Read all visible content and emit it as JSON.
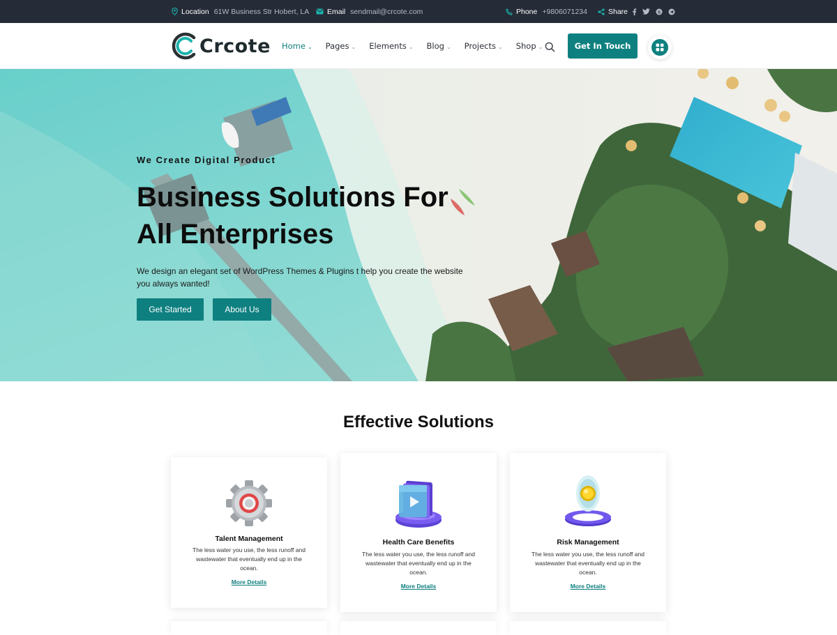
{
  "topbar": {
    "location_label": "Location",
    "location_value": "61W Business Str Hobert, LA",
    "email_label": "Email",
    "email_value": "sendmail@crcote.com",
    "phone_label": "Phone",
    "phone_value": "+9806071234",
    "share_label": "Share",
    "socials": [
      "facebook-icon",
      "twitter-icon",
      "skype-icon",
      "telegram-icon"
    ]
  },
  "brand": {
    "name": "Crcote",
    "accent_color": "#0f8080",
    "topbar_color": "#252b37"
  },
  "nav": {
    "items": [
      {
        "label": "Home",
        "active": true
      },
      {
        "label": "Pages",
        "active": false
      },
      {
        "label": "Elements",
        "active": false
      },
      {
        "label": "Blog",
        "active": false
      },
      {
        "label": "Projects",
        "active": false
      },
      {
        "label": "Shop",
        "active": false
      }
    ],
    "cta_label": "Get In Touch"
  },
  "hero": {
    "kicker": "We Create Digital Product",
    "headline_line1": "Business Solutions For",
    "headline_line2": "All Enterprises",
    "description": "We design an elegant set of WordPress Themes & Plugins t help you create the website you always wanted!",
    "primary_button": "Get Started",
    "secondary_button": "About Us"
  },
  "solutions": {
    "title": "Effective Solutions",
    "cards": [
      {
        "title": "Talent Management",
        "text": "The less water you use, the less runoff and wastewater that eventually end up in the ocean.",
        "link": "More Details",
        "icon": "gear-icon"
      },
      {
        "title": "Health Care Benefits",
        "text": "The less water you use, the less runoff and wastewater that eventually end up in the ocean.",
        "link": "More Details",
        "icon": "video-folder-icon"
      },
      {
        "title": "Risk Management",
        "text": "The less water you use, the less runoff and wastewater that eventually end up in the ocean.",
        "link": "More Details",
        "icon": "location-ring-icon"
      }
    ]
  }
}
